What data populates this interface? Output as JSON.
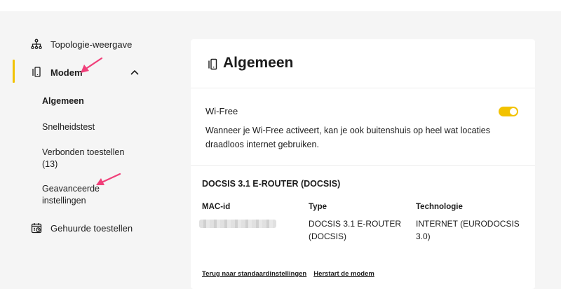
{
  "sidebar": {
    "topology_label": "Topologie-weergave",
    "modem_label": "Modem",
    "sub_items": {
      "algemeen": "Algemeen",
      "snelheidstest": "Snelheidstest",
      "verbonden_line1": "Verbonden toestellen",
      "verbonden_line2": "(13)",
      "geavanceerd_line1": "Geavanceerde",
      "geavanceerd_line2": "instellingen"
    },
    "gehuurd_label": "Gehuurde toestellen"
  },
  "card": {
    "title": "Algemeen",
    "wifi": {
      "title": "Wi-Free",
      "enabled": true,
      "description": "Wanneer je Wi-Free activeert, kan je ook buitenshuis op heel wat locaties draadloos internet gebruiken."
    },
    "device": {
      "title": "DOCSIS 3.1 E-ROUTER (DOCSIS)",
      "mac_label": "MAC-id",
      "type_label": "Type",
      "type_value_line1": "DOCSIS 3.1 E-ROUTER",
      "type_value_line2": "(DOCSIS)",
      "tech_label": "Technologie",
      "tech_value_line1": "INTERNET (EURODOCSIS",
      "tech_value_line2": "3.0)"
    },
    "links": {
      "reset": "Terug naar standaardinstellingen",
      "restart": "Herstart de modem"
    }
  },
  "colors": {
    "accent": "#f2c200",
    "annotation_arrow": "#f0407a"
  }
}
